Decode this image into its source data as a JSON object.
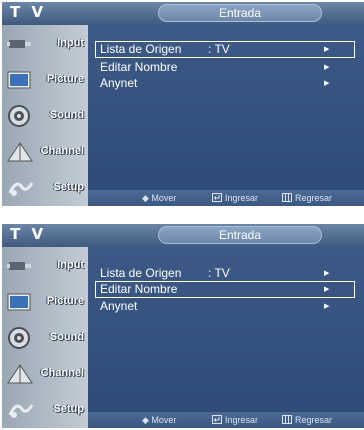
{
  "screens": [
    {
      "header": {
        "tv_label": "T V",
        "title": "Entrada"
      },
      "sidebar": [
        {
          "label": "Input",
          "icon": "input-icon"
        },
        {
          "label": "Picture",
          "icon": "picture-icon"
        },
        {
          "label": "Sound",
          "icon": "sound-icon"
        },
        {
          "label": "Channel",
          "icon": "channel-icon"
        },
        {
          "label": "Setup",
          "icon": "setup-icon"
        }
      ],
      "menu": [
        {
          "name": "Lista de Origen",
          "value": ": TV",
          "arrow": "▶",
          "selected": true
        },
        {
          "name": "Editar Nombre",
          "value": "",
          "arrow": "▶",
          "selected": false
        },
        {
          "name": "Anynet",
          "value": "",
          "arrow": "▶",
          "selected": false
        }
      ],
      "footer": {
        "move": "◆ Mover",
        "enter": "Ingresar",
        "return": "Regresar"
      }
    },
    {
      "header": {
        "tv_label": "T V",
        "title": "Entrada"
      },
      "sidebar": [
        {
          "label": "Input",
          "icon": "input-icon"
        },
        {
          "label": "Picture",
          "icon": "picture-icon"
        },
        {
          "label": "Sound",
          "icon": "sound-icon"
        },
        {
          "label": "Channel",
          "icon": "channel-icon"
        },
        {
          "label": "Setup",
          "icon": "setup-icon"
        }
      ],
      "menu": [
        {
          "name": "Lista de Origen",
          "value": ": TV",
          "arrow": "▶",
          "selected": false
        },
        {
          "name": "Editar Nombre",
          "value": "",
          "arrow": "▶",
          "selected": true
        },
        {
          "name": "Anynet",
          "value": "",
          "arrow": "▶",
          "selected": false
        }
      ],
      "footer": {
        "move": "◆ Mover",
        "enter": "Ingresar",
        "return": "Regresar"
      }
    }
  ]
}
